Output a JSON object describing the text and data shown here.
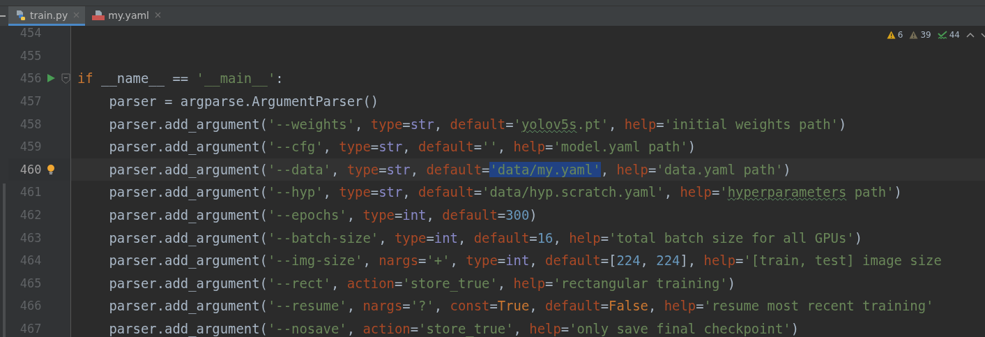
{
  "tabs": [
    {
      "label": "train.py",
      "kind": "python",
      "selected": true
    },
    {
      "label": "my.yaml",
      "kind": "yaml",
      "selected": false
    }
  ],
  "inspections": [
    {
      "kind": "warning",
      "count": "6"
    },
    {
      "kind": "weak",
      "count": "39"
    },
    {
      "kind": "typo",
      "count": "44"
    }
  ],
  "lines": [
    {
      "number": "454",
      "current": false,
      "fold": false,
      "run": false,
      "hint": false
    },
    {
      "number": "455",
      "current": false,
      "fold": false,
      "run": false,
      "hint": false
    },
    {
      "number": "456",
      "current": false,
      "fold": true,
      "run": true,
      "hint": false,
      "tokens": [
        {
          "kind": "keyword",
          "text": "if"
        },
        {
          "kind": "text",
          "text": " __name__ == "
        },
        {
          "kind": "string",
          "text": "'__main__'"
        },
        {
          "kind": "text",
          "text": ":"
        }
      ]
    },
    {
      "number": "457",
      "current": false,
      "fold": false,
      "run": false,
      "hint": false,
      "tokens": [
        {
          "kind": "text",
          "text": "    parser = argparse.ArgumentParser()"
        }
      ]
    },
    {
      "number": "458",
      "current": false,
      "fold": false,
      "run": false,
      "hint": false,
      "tokens": [
        {
          "kind": "text",
          "text": "    parser.add_argument("
        },
        {
          "kind": "string",
          "text": "'--weights'"
        },
        {
          "kind": "text",
          "text": ", "
        },
        {
          "kind": "arg",
          "text": "type"
        },
        {
          "kind": "text",
          "text": "="
        },
        {
          "kind": "builtin",
          "text": "str"
        },
        {
          "kind": "text",
          "text": ", "
        },
        {
          "kind": "arg",
          "text": "default"
        },
        {
          "kind": "text",
          "text": "="
        },
        {
          "kind": "string",
          "text": "'"
        },
        {
          "kind": "string",
          "text": "yolov5s",
          "typo": true
        },
        {
          "kind": "string",
          "text": ".pt'"
        },
        {
          "kind": "text",
          "text": ", "
        },
        {
          "kind": "arg",
          "text": "help"
        },
        {
          "kind": "text",
          "text": "="
        },
        {
          "kind": "string",
          "text": "'initial weights path'"
        },
        {
          "kind": "text",
          "text": ")"
        }
      ]
    },
    {
      "number": "459",
      "current": false,
      "fold": false,
      "run": false,
      "hint": false,
      "tokens": [
        {
          "kind": "text",
          "text": "    parser.add_argument("
        },
        {
          "kind": "string",
          "text": "'--cfg'"
        },
        {
          "kind": "text",
          "text": ", "
        },
        {
          "kind": "arg",
          "text": "type"
        },
        {
          "kind": "text",
          "text": "="
        },
        {
          "kind": "builtin",
          "text": "str"
        },
        {
          "kind": "text",
          "text": ", "
        },
        {
          "kind": "arg",
          "text": "default"
        },
        {
          "kind": "text",
          "text": "="
        },
        {
          "kind": "string",
          "text": "''"
        },
        {
          "kind": "text",
          "text": ", "
        },
        {
          "kind": "arg",
          "text": "help"
        },
        {
          "kind": "text",
          "text": "="
        },
        {
          "kind": "string",
          "text": "'model.yaml path'"
        },
        {
          "kind": "text",
          "text": ")"
        }
      ]
    },
    {
      "number": "460",
      "current": true,
      "fold": false,
      "run": false,
      "hint": true,
      "tokens": [
        {
          "kind": "text",
          "text": "    parser.add_argument("
        },
        {
          "kind": "string",
          "text": "'--data'"
        },
        {
          "kind": "text",
          "text": ", "
        },
        {
          "kind": "arg",
          "text": "type"
        },
        {
          "kind": "text",
          "text": "="
        },
        {
          "kind": "builtin",
          "text": "str"
        },
        {
          "kind": "text",
          "text": ", "
        },
        {
          "kind": "arg",
          "text": "default"
        },
        {
          "kind": "text",
          "text": "="
        },
        {
          "kind": "string",
          "text": "'data/my.yaml'",
          "selected": true
        },
        {
          "kind": "text",
          "text": ", "
        },
        {
          "kind": "arg",
          "text": "help"
        },
        {
          "kind": "text",
          "text": "="
        },
        {
          "kind": "string",
          "text": "'data.yaml path'"
        },
        {
          "kind": "text",
          "text": ")"
        }
      ]
    },
    {
      "number": "461",
      "current": false,
      "fold": false,
      "run": false,
      "hint": false,
      "tokens": [
        {
          "kind": "text",
          "text": "    parser.add_argument("
        },
        {
          "kind": "string",
          "text": "'--hyp'"
        },
        {
          "kind": "text",
          "text": ", "
        },
        {
          "kind": "arg",
          "text": "type"
        },
        {
          "kind": "text",
          "text": "="
        },
        {
          "kind": "builtin",
          "text": "str"
        },
        {
          "kind": "text",
          "text": ", "
        },
        {
          "kind": "arg",
          "text": "default"
        },
        {
          "kind": "text",
          "text": "="
        },
        {
          "kind": "string",
          "text": "'data/hyp.scratch.yaml'"
        },
        {
          "kind": "text",
          "text": ", "
        },
        {
          "kind": "arg",
          "text": "help"
        },
        {
          "kind": "text",
          "text": "="
        },
        {
          "kind": "string",
          "text": "'"
        },
        {
          "kind": "string",
          "text": "hyperparameters",
          "typo": true
        },
        {
          "kind": "string",
          "text": " path'"
        },
        {
          "kind": "text",
          "text": ")"
        }
      ]
    },
    {
      "number": "462",
      "current": false,
      "fold": false,
      "run": false,
      "hint": false,
      "tokens": [
        {
          "kind": "text",
          "text": "    parser.add_argument("
        },
        {
          "kind": "string",
          "text": "'--epochs'"
        },
        {
          "kind": "text",
          "text": ", "
        },
        {
          "kind": "arg",
          "text": "type"
        },
        {
          "kind": "text",
          "text": "="
        },
        {
          "kind": "builtin",
          "text": "int"
        },
        {
          "kind": "text",
          "text": ", "
        },
        {
          "kind": "arg",
          "text": "default"
        },
        {
          "kind": "text",
          "text": "="
        },
        {
          "kind": "number",
          "text": "300"
        },
        {
          "kind": "text",
          "text": ")"
        }
      ]
    },
    {
      "number": "463",
      "current": false,
      "fold": false,
      "run": false,
      "hint": false,
      "tokens": [
        {
          "kind": "text",
          "text": "    parser.add_argument("
        },
        {
          "kind": "string",
          "text": "'--batch-size'"
        },
        {
          "kind": "text",
          "text": ", "
        },
        {
          "kind": "arg",
          "text": "type"
        },
        {
          "kind": "text",
          "text": "="
        },
        {
          "kind": "builtin",
          "text": "int"
        },
        {
          "kind": "text",
          "text": ", "
        },
        {
          "kind": "arg",
          "text": "default"
        },
        {
          "kind": "text",
          "text": "="
        },
        {
          "kind": "number",
          "text": "16"
        },
        {
          "kind": "text",
          "text": ", "
        },
        {
          "kind": "arg",
          "text": "help"
        },
        {
          "kind": "text",
          "text": "="
        },
        {
          "kind": "string",
          "text": "'total batch size for all GPUs'"
        },
        {
          "kind": "text",
          "text": ")"
        }
      ]
    },
    {
      "number": "464",
      "current": false,
      "fold": false,
      "run": false,
      "hint": false,
      "tokens": [
        {
          "kind": "text",
          "text": "    parser.add_argument("
        },
        {
          "kind": "string",
          "text": "'--img-size'"
        },
        {
          "kind": "text",
          "text": ", "
        },
        {
          "kind": "arg",
          "text": "nargs"
        },
        {
          "kind": "text",
          "text": "="
        },
        {
          "kind": "string",
          "text": "'+'"
        },
        {
          "kind": "text",
          "text": ", "
        },
        {
          "kind": "arg",
          "text": "type"
        },
        {
          "kind": "text",
          "text": "="
        },
        {
          "kind": "builtin",
          "text": "int"
        },
        {
          "kind": "text",
          "text": ", "
        },
        {
          "kind": "arg",
          "text": "default"
        },
        {
          "kind": "text",
          "text": "=["
        },
        {
          "kind": "number",
          "text": "224"
        },
        {
          "kind": "text",
          "text": ", "
        },
        {
          "kind": "number",
          "text": "224"
        },
        {
          "kind": "text",
          "text": "], "
        },
        {
          "kind": "arg",
          "text": "help"
        },
        {
          "kind": "text",
          "text": "="
        },
        {
          "kind": "string",
          "text": "'[train, test] image size"
        }
      ]
    },
    {
      "number": "465",
      "current": false,
      "fold": false,
      "run": false,
      "hint": false,
      "tokens": [
        {
          "kind": "text",
          "text": "    parser.add_argument("
        },
        {
          "kind": "string",
          "text": "'--rect'"
        },
        {
          "kind": "text",
          "text": ", "
        },
        {
          "kind": "arg",
          "text": "action"
        },
        {
          "kind": "text",
          "text": "="
        },
        {
          "kind": "string",
          "text": "'store_true'"
        },
        {
          "kind": "text",
          "text": ", "
        },
        {
          "kind": "arg",
          "text": "help"
        },
        {
          "kind": "text",
          "text": "="
        },
        {
          "kind": "string",
          "text": "'rectangular training'"
        },
        {
          "kind": "text",
          "text": ")"
        }
      ]
    },
    {
      "number": "466",
      "current": false,
      "fold": false,
      "run": false,
      "hint": false,
      "tokens": [
        {
          "kind": "text",
          "text": "    parser.add_argument("
        },
        {
          "kind": "string",
          "text": "'--resume'"
        },
        {
          "kind": "text",
          "text": ", "
        },
        {
          "kind": "arg",
          "text": "nargs"
        },
        {
          "kind": "text",
          "text": "="
        },
        {
          "kind": "string",
          "text": "'?'"
        },
        {
          "kind": "text",
          "text": ", "
        },
        {
          "kind": "arg",
          "text": "const"
        },
        {
          "kind": "text",
          "text": "="
        },
        {
          "kind": "keyword",
          "text": "True"
        },
        {
          "kind": "text",
          "text": ", "
        },
        {
          "kind": "arg",
          "text": "default"
        },
        {
          "kind": "text",
          "text": "="
        },
        {
          "kind": "keyword",
          "text": "False"
        },
        {
          "kind": "text",
          "text": ", "
        },
        {
          "kind": "arg",
          "text": "help"
        },
        {
          "kind": "text",
          "text": "="
        },
        {
          "kind": "string",
          "text": "'resume most recent training'"
        }
      ]
    },
    {
      "number": "467",
      "current": false,
      "fold": false,
      "run": false,
      "hint": false,
      "tokens": [
        {
          "kind": "text",
          "text": "    parser.add_argument("
        },
        {
          "kind": "string",
          "text": "'--nosave'"
        },
        {
          "kind": "text",
          "text": ", "
        },
        {
          "kind": "arg",
          "text": "action"
        },
        {
          "kind": "text",
          "text": "="
        },
        {
          "kind": "string",
          "text": "'store_true'"
        },
        {
          "kind": "text",
          "text": ", "
        },
        {
          "kind": "arg",
          "text": "help"
        },
        {
          "kind": "text",
          "text": "="
        },
        {
          "kind": "string",
          "text": "'only save final checkpoint'"
        },
        {
          "kind": "text",
          "text": ")"
        }
      ]
    }
  ]
}
